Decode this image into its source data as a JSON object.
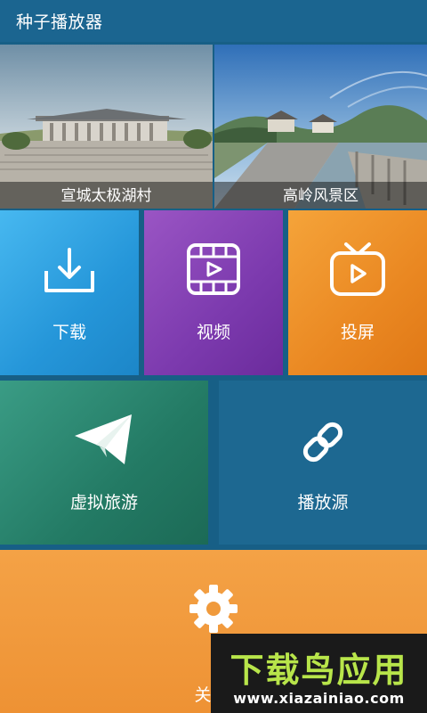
{
  "app": {
    "title": "种子播放器"
  },
  "banners": [
    {
      "caption": "宣城太极湖村"
    },
    {
      "caption": "高岭风景区"
    }
  ],
  "tiles": {
    "download": {
      "label": "下载",
      "icon": "download-icon",
      "color": "#2596d9"
    },
    "video": {
      "label": "视频",
      "icon": "film-icon",
      "color": "#7c3aae"
    },
    "cast": {
      "label": "投屏",
      "icon": "tv-play-icon",
      "color": "#ea8822"
    },
    "vr": {
      "label": "虚拟旅游",
      "icon": "paper-plane-icon",
      "color": "#237a64"
    },
    "source": {
      "label": "播放源",
      "icon": "link-icon",
      "color": "#1d6891"
    },
    "about": {
      "label": "关",
      "icon": "gear-icon",
      "color": "#ee9234"
    }
  },
  "watermark": {
    "brand": "下载鸟应用",
    "url": "www.xiazainiao.com"
  }
}
